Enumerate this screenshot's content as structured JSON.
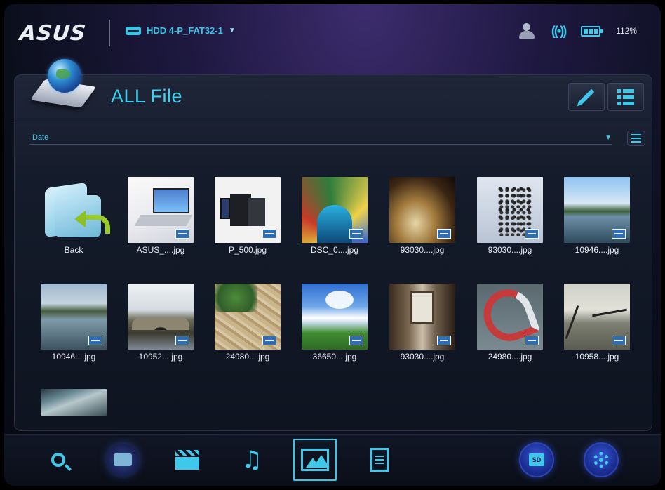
{
  "header": {
    "brand": "ASUS",
    "drive_label": "HDD 4-P_FAT32-1",
    "battery_percent": "112%"
  },
  "panel": {
    "title": "ALL File",
    "sort_label": "Date"
  },
  "items": [
    {
      "name": "Back",
      "thumb": "back-folder-icon"
    },
    {
      "name": "ASUS_....jpg",
      "thumb": "laptop"
    },
    {
      "name": "P_500.jpg",
      "thumb": "p500"
    },
    {
      "name": "DSC_0....jpg",
      "thumb": "stained-glass"
    },
    {
      "name": "93030....jpg",
      "thumb": "bowl"
    },
    {
      "name": "93030....jpg",
      "thumb": "tree"
    },
    {
      "name": "10946....jpg",
      "thumb": "lake"
    },
    {
      "name": "10946....jpg",
      "thumb": "lake2"
    },
    {
      "name": "10952....jpg",
      "thumb": "bridge"
    },
    {
      "name": "24980....jpg",
      "thumb": "map"
    },
    {
      "name": "36650....jpg",
      "thumb": "sky"
    },
    {
      "name": "93030....jpg",
      "thumb": "room"
    },
    {
      "name": "24980....jpg",
      "thumb": "red-loop"
    },
    {
      "name": "10958....jpg",
      "thumb": "dock"
    },
    {
      "name": "",
      "thumb": "clouds"
    }
  ],
  "nav": {
    "selected": "photo",
    "items": [
      "search-icon",
      "folder-icon",
      "video-icon",
      "music-icon",
      "photo-icon",
      "document-icon",
      "sd-card-icon",
      "settings-gear-icon"
    ]
  },
  "colors": {
    "accent": "#3fc8ea",
    "background": "#0b0f1c"
  }
}
